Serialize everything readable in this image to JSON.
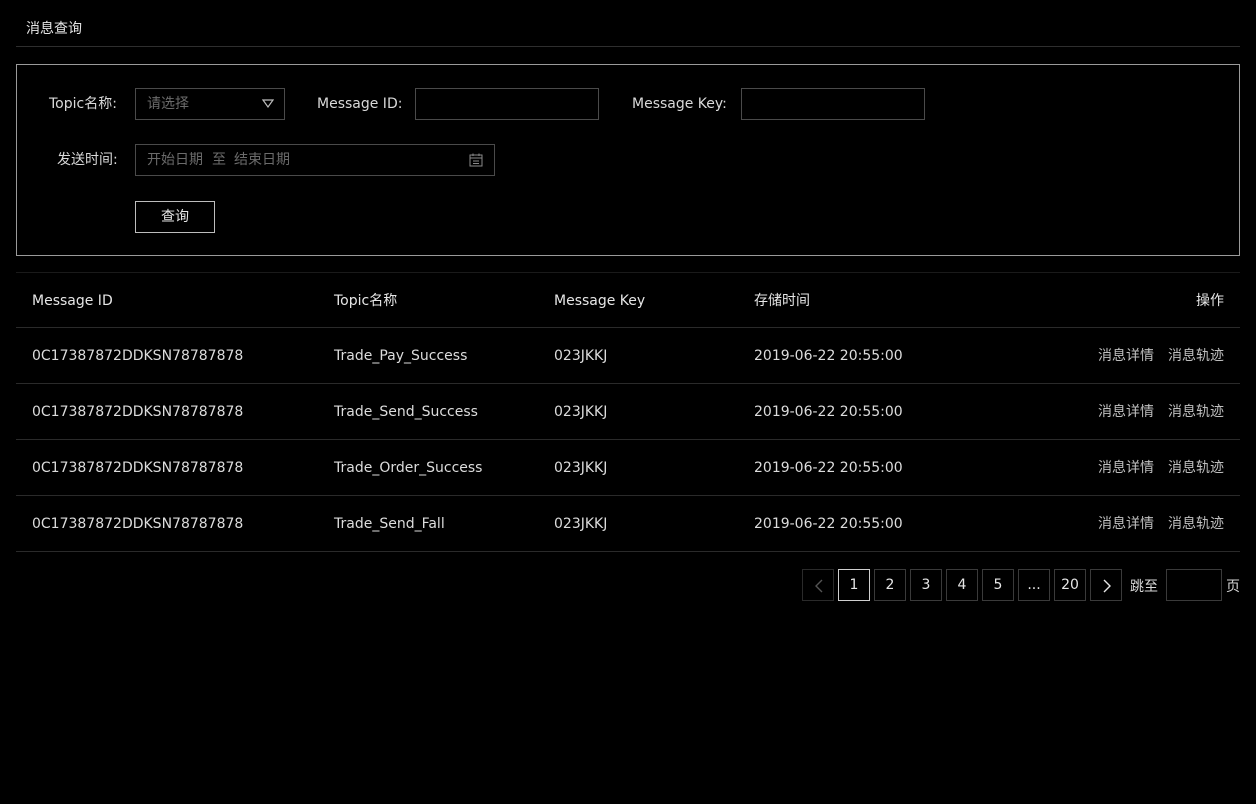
{
  "header": {
    "title": "消息查询"
  },
  "search": {
    "topic_label": "Topic名称:",
    "topic_placeholder": "请选择",
    "message_id_label": "Message ID:",
    "message_id_value": "",
    "message_key_label": "Message Key:",
    "message_key_value": "",
    "send_time_label": "发送时间:",
    "start_date_placeholder": "开始日期",
    "date_separator": "至",
    "end_date_placeholder": "结束日期",
    "query_button": "查询"
  },
  "table": {
    "columns": [
      "Message ID",
      "Topic名称",
      "Message Key",
      "存储时间",
      "操作"
    ],
    "rows": [
      {
        "message_id": "0C17387872DDKSN78787878",
        "topic": "Trade_Pay_Success",
        "message_key": "023JKKJ",
        "time": "2019-06-22 20:55:00",
        "action_detail": "消息详情",
        "action_trace": "消息轨迹"
      },
      {
        "message_id": "0C17387872DDKSN78787878",
        "topic": "Trade_Send_Success",
        "message_key": "023JKKJ",
        "time": "2019-06-22 20:55:00",
        "action_detail": "消息详情",
        "action_trace": "消息轨迹"
      },
      {
        "message_id": "0C17387872DDKSN78787878",
        "topic": "Trade_Order_Success",
        "message_key": "023JKKJ",
        "time": "2019-06-22 20:55:00",
        "action_detail": "消息详情",
        "action_trace": "消息轨迹"
      },
      {
        "message_id": "0C17387872DDKSN78787878",
        "topic": "Trade_Send_Fall",
        "message_key": "023JKKJ",
        "time": "2019-06-22 20:55:00",
        "action_detail": "消息详情",
        "action_trace": "消息轨迹"
      }
    ]
  },
  "pagination": {
    "pages": [
      "1",
      "2",
      "3",
      "4",
      "5",
      "...",
      "20"
    ],
    "current": "1",
    "jump_label": "跳至",
    "page_suffix": "页",
    "jump_value": ""
  },
  "icons": {
    "select_arrow": "chevron-down-icon",
    "calendar": "calendar-icon",
    "prev": "chevron-left-icon",
    "next": "chevron-right-icon"
  }
}
